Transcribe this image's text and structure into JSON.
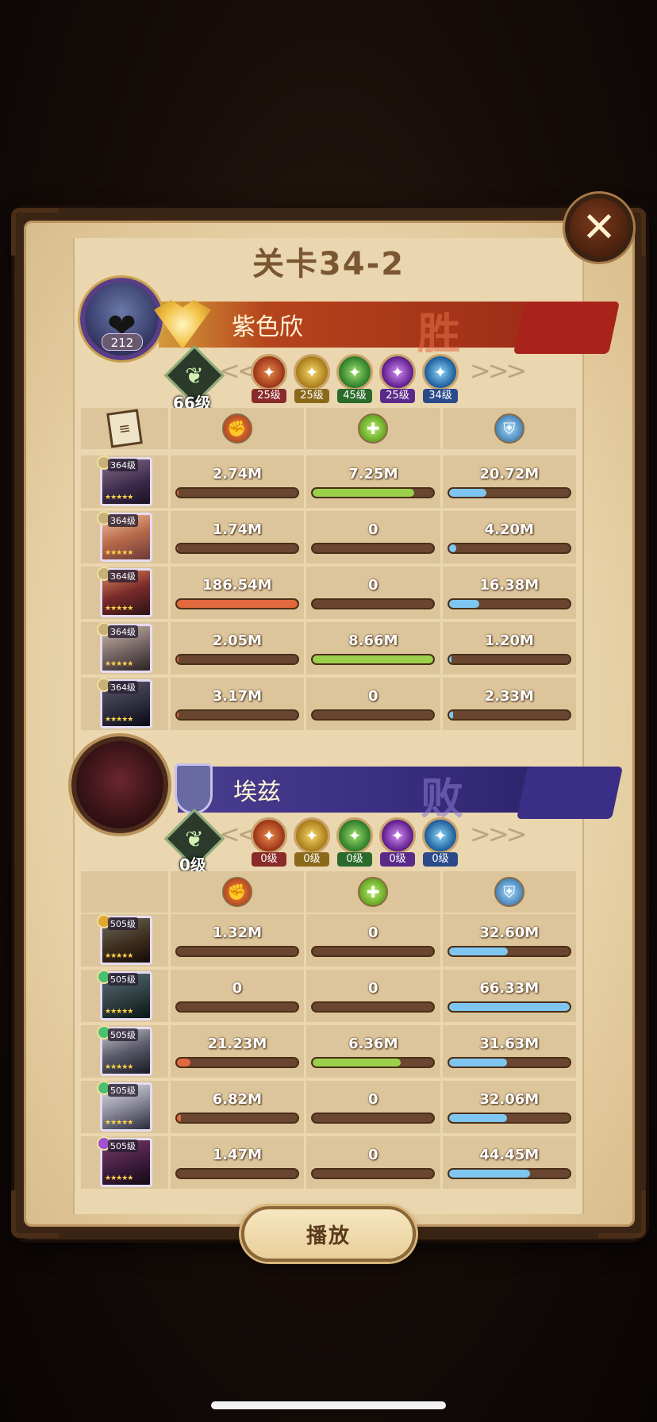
{
  "title": "关卡34-2",
  "close_label": "✕",
  "play_label": "播放",
  "winner": {
    "avatar_level": "212",
    "name": "紫色欣",
    "result": "胜",
    "formation_level": "66级",
    "factions": [
      "25级",
      "25级",
      "45级",
      "25级",
      "34级"
    ],
    "heroes": [
      {
        "level": "364级",
        "stars": "★★★★★",
        "dmg": "2.74M",
        "heal": "7.25M",
        "def": "20.72M",
        "dmg_pct": 0.015,
        "heal_pct": 0.84,
        "def_pct": 0.31
      },
      {
        "level": "364级",
        "stars": "★★★★★",
        "dmg": "1.74M",
        "heal": "0",
        "def": "4.20M",
        "dmg_pct": 0.01,
        "heal_pct": 0,
        "def_pct": 0.06
      },
      {
        "level": "364级",
        "stars": "★★★★★",
        "dmg": "186.54M",
        "heal": "0",
        "def": "16.38M",
        "dmg_pct": 1.0,
        "heal_pct": 0,
        "def_pct": 0.25
      },
      {
        "level": "364级",
        "stars": "★★★★★",
        "dmg": "2.05M",
        "heal": "8.66M",
        "def": "1.20M",
        "dmg_pct": 0.011,
        "heal_pct": 1.0,
        "def_pct": 0.02
      },
      {
        "level": "364级",
        "stars": "★★★★★",
        "dmg": "3.17M",
        "heal": "0",
        "def": "2.33M",
        "dmg_pct": 0.017,
        "heal_pct": 0,
        "def_pct": 0.035
      }
    ]
  },
  "loser": {
    "name": "埃兹",
    "result": "败",
    "formation_level": "0级",
    "factions": [
      "0级",
      "0级",
      "0级",
      "0级",
      "0级"
    ],
    "heroes": [
      {
        "level": "505级",
        "stars": "★★★★★",
        "dmg": "1.32M",
        "heal": "0",
        "def": "32.60M",
        "dmg_pct": 0.0,
        "heal_pct": 0,
        "def_pct": 0.49
      },
      {
        "level": "505级",
        "stars": "★★★★★",
        "dmg": "0",
        "heal": "0",
        "def": "66.33M",
        "dmg_pct": 0,
        "heal_pct": 0,
        "def_pct": 1.0
      },
      {
        "level": "505级",
        "stars": "★★★★★",
        "dmg": "21.23M",
        "heal": "6.36M",
        "def": "31.63M",
        "dmg_pct": 0.11,
        "heal_pct": 0.73,
        "def_pct": 0.48
      },
      {
        "level": "505级",
        "stars": "★★★★★",
        "dmg": "6.82M",
        "heal": "0",
        "def": "32.06M",
        "dmg_pct": 0.035,
        "heal_pct": 0,
        "def_pct": 0.48
      },
      {
        "level": "505级",
        "stars": "★★★★★",
        "dmg": "1.47M",
        "heal": "0",
        "def": "44.45M",
        "dmg_pct": 0.0,
        "heal_pct": 0,
        "def_pct": 0.67
      }
    ]
  }
}
